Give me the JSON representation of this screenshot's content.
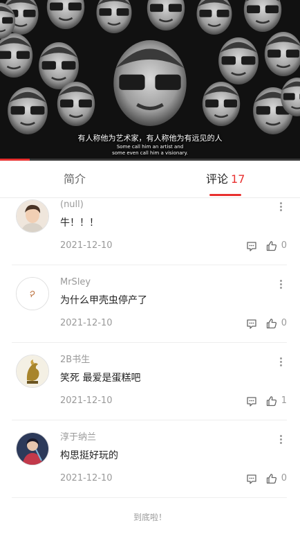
{
  "video": {
    "subtitle_zh": "有人称他为艺术家，有人称他为有远见的人",
    "subtitle_en_line1": "Some call him an artist and",
    "subtitle_en_line2": "some even call him a visionary.",
    "progress_fraction": 0.1
  },
  "tabs": {
    "intro_label": "简介",
    "comments_label": "评论",
    "comments_count": "17"
  },
  "comments": [
    {
      "user": "(null)",
      "text": "牛！！！",
      "date": "2021-12-10",
      "likes": "0"
    },
    {
      "user": "MrSley",
      "text": "为什么甲壳虫停产了",
      "date": "2021-12-10",
      "likes": "0"
    },
    {
      "user": "2B书生",
      "text": "笑死 最爱是蛋糕吧",
      "date": "2021-12-10",
      "likes": "1"
    },
    {
      "user": "淳于纳兰",
      "text": "构思挺好玩的",
      "date": "2021-12-10",
      "likes": "0"
    }
  ],
  "footer": {
    "end_text": "到底啦！"
  },
  "colors": {
    "accent": "#e8302f",
    "muted": "#999999"
  }
}
